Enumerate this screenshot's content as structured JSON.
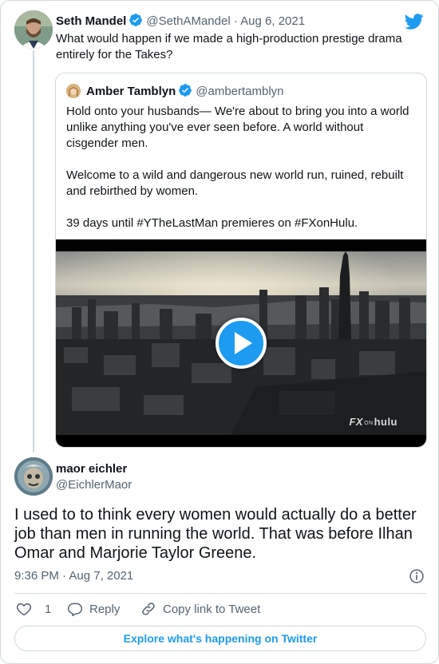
{
  "colors": {
    "accent": "#1d9bf0",
    "text": "#0f1419",
    "muted": "#536471",
    "border": "#cfd9de"
  },
  "top_tweet": {
    "author_name": "Seth Mandel",
    "author_handle": "@SethAMandel",
    "date": "Aug 6, 2021",
    "text": "What would happen if we made a high-production prestige drama entirely for the Takes?",
    "avatar_icon": "person-avatar",
    "verified_icon": "verified-badge-icon"
  },
  "quoted_tweet": {
    "author_name": "Amber Tamblyn",
    "author_handle": "@ambertamblyn",
    "paragraphs": [
      "Hold onto your husbands— We're about to bring you into a world unlike anything you've ever seen before. A world without cisgender men.",
      "Welcome to a wild and dangerous new world run, ruined, rebuilt and rebirthed by women.",
      "39 days until #YTheLastMan premieres on #FXonHulu."
    ],
    "video_logo": {
      "fx": "FX",
      "on": "ON",
      "hulu": "hulu"
    }
  },
  "main_tweet": {
    "author_name": "maor eichler",
    "author_handle": "@EichlerMaor",
    "text": "I used to to think every women would actually do a better job than men in running the world. That was before Ilhan Omar and Marjorie Taylor Greene.",
    "timestamp": "9:36 PM · Aug 7, 2021"
  },
  "actions": {
    "like_count": "1",
    "reply_label": "Reply",
    "copy_label": "Copy link to Tweet"
  },
  "explore_label": "Explore what's happening on Twitter"
}
